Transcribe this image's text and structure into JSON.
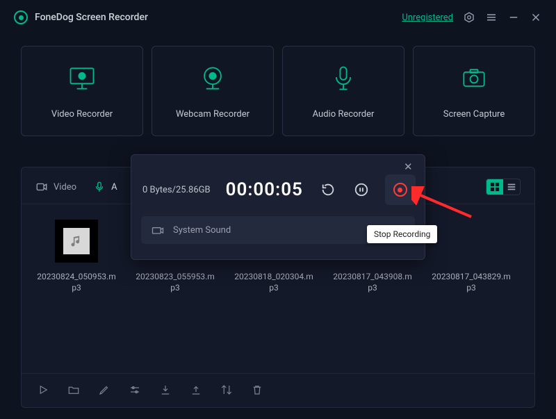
{
  "app": {
    "title": "FoneDog Screen Recorder",
    "unregistered_label": "Unregistered"
  },
  "modes": [
    {
      "label": "Video Recorder"
    },
    {
      "label": "Webcam Recorder"
    },
    {
      "label": "Audio Recorder"
    },
    {
      "label": "Screen Capture"
    }
  ],
  "library": {
    "tabs": {
      "video": "Video",
      "audio": "A"
    },
    "files": [
      {
        "name": "20230824_050953.mp3"
      },
      {
        "name": "20230823_055953.mp3"
      },
      {
        "name": "20230818_020304.mp3"
      },
      {
        "name": "20230817_043908.mp3"
      },
      {
        "name": "20230817_043829.mp3"
      }
    ]
  },
  "recording": {
    "size_status": "0 Bytes/25.86GB",
    "elapsed": "00:00:05",
    "source_label": "System Sound",
    "tooltip": "Stop Recording"
  }
}
